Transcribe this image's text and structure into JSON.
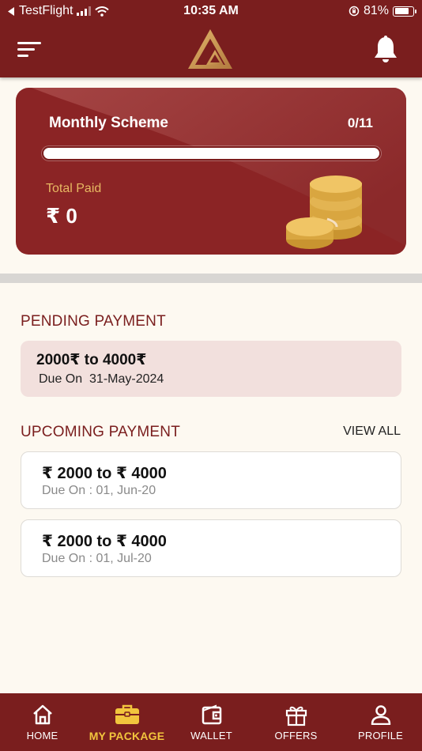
{
  "status_bar": {
    "back_app": "TestFlight",
    "time": "10:35 AM",
    "battery": "81%",
    "battery_level": 0.81
  },
  "header": {
    "menu_icon": "menu-icon",
    "logo_icon": "triangle-logo-icon",
    "notification_icon": "bell-icon"
  },
  "scheme_card": {
    "title": "Monthly Scheme",
    "count": "0/11",
    "progress": 0,
    "paid_label": "Total Paid",
    "paid_amount": "₹ 0"
  },
  "pending": {
    "title": "PENDING PAYMENT",
    "amount": "2000₹  to 4000₹",
    "due_label": "Due On",
    "due_date": "31-May-2024"
  },
  "upcoming": {
    "title": "UPCOMING PAYMENT",
    "view_all": "VIEW ALL",
    "items": [
      {
        "amount": "₹ 2000  to  ₹ 4000",
        "due": "Due On  : 01, Jun-20"
      },
      {
        "amount": "₹ 2000  to  ₹ 4000",
        "due": "Due On  : 01, Jul-20"
      }
    ]
  },
  "tabs": [
    {
      "label": "HOME",
      "icon": "home-icon",
      "active": false
    },
    {
      "label": "MY PACKAGE",
      "icon": "briefcase-icon",
      "active": true
    },
    {
      "label": "WALLET",
      "icon": "wallet-icon",
      "active": false
    },
    {
      "label": "OFFERS",
      "icon": "gift-icon",
      "active": false
    },
    {
      "label": "PROFILE",
      "icon": "user-icon",
      "active": false
    }
  ],
  "colors": {
    "brand": "#7a1e1e",
    "card": "#8b2425",
    "gold": "#e7b862",
    "active_tab": "#f2c53d",
    "background": "#fdf9f1",
    "pending_bg": "#f2e0dd"
  }
}
